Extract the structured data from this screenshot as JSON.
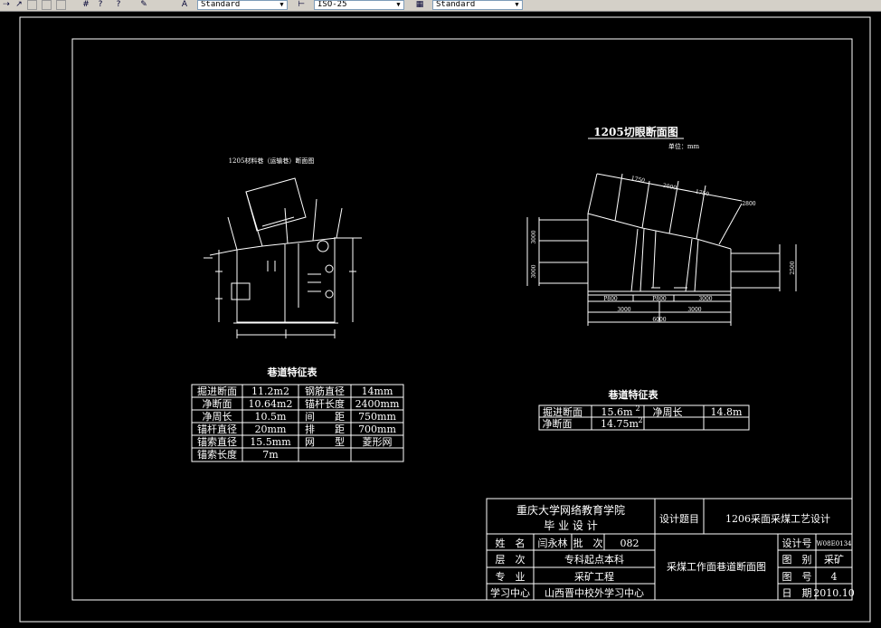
{
  "toolbar": {
    "text_style": "Standard",
    "dim_style": "ISO-25",
    "table_style": "Standard"
  },
  "left_drawing": {
    "title": "1205材料巷（运输巷）断面图"
  },
  "right_drawing": {
    "title": "1205切眼断面图",
    "unit": "单位：mm",
    "dims": {
      "top_1750_a": "1750",
      "top_2000": "2000",
      "top_1750_b": "1750",
      "right_2800": "2800",
      "left_3000_a": "3000",
      "left_3000_b": "3000",
      "bottom_1_a": "P800",
      "bottom_1_b": "P800",
      "bottom_1_c": "3000",
      "bottom_2_a": "3000",
      "bottom_2_b": "3000",
      "bottom_total": "6000",
      "right_h": "2500"
    }
  },
  "left_table": {
    "title": "巷道特征表",
    "rows": [
      [
        "掘进断面",
        "11.2m2",
        "钢筋直径",
        "14mm"
      ],
      [
        "净断面",
        "10.64m2",
        "锚杆长度",
        "2400mm"
      ],
      [
        "净周长",
        "10.5m",
        "间　　距",
        "750mm"
      ],
      [
        "锚杆直径",
        "20mm",
        "排　　距",
        "700mm"
      ],
      [
        "锚索直径",
        "15.5mm",
        "网　　型",
        "菱形网"
      ],
      [
        "锚索长度",
        "7m",
        "",
        ""
      ]
    ]
  },
  "right_table": {
    "title": "巷道特征表",
    "rows": [
      [
        "掘进断面",
        "15.6m",
        "2",
        "净周长",
        "14.8m"
      ],
      [
        "净断面",
        "14.75m",
        "2",
        "",
        ""
      ]
    ]
  },
  "title_block": {
    "school": "重庆大学网络教育学院",
    "design": "毕 业 设 计",
    "topic_label": "设计题目",
    "topic": "1206采面采煤工艺设计",
    "name_label": "姓　名",
    "name": "闫永林",
    "batch_label": "批　次",
    "batch": "082",
    "level_label": "层　次",
    "level": "专科起点本科",
    "major_label": "专　业",
    "major": "采矿工程",
    "center_label": "学习中心",
    "center": "山西晋中校外学习中心",
    "drawing_name": "采煤工作面巷道断面图",
    "design_no_label": "设计号",
    "design_no": "W08E0134",
    "category_label": "图　别",
    "category": "采矿",
    "number_label": "图　号",
    "number": "4",
    "date_label": "日　期",
    "date": "2010.10"
  }
}
